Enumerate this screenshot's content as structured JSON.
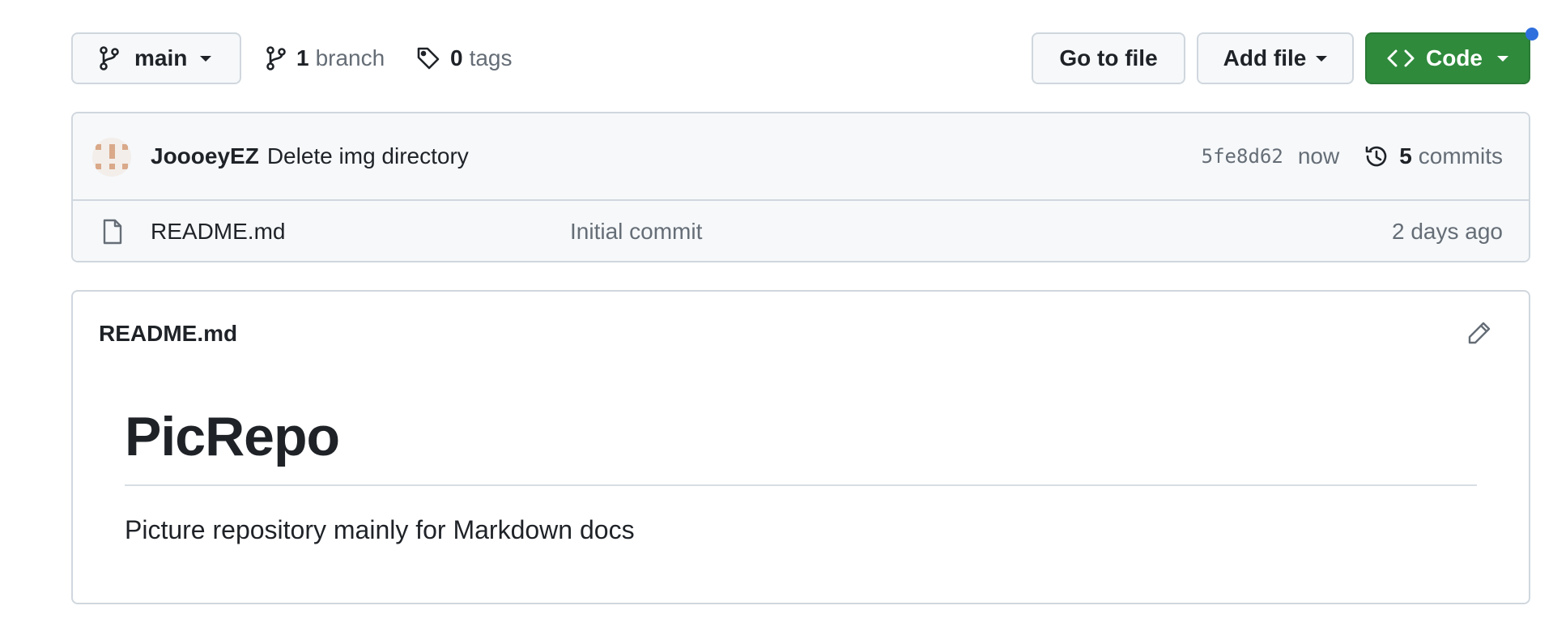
{
  "toolbar": {
    "branch_label": "main",
    "branches_count": "1",
    "branches_label": "branch",
    "tags_count": "0",
    "tags_label": "tags",
    "goto_file_label": "Go to file",
    "add_file_label": "Add file",
    "code_label": "Code"
  },
  "latest_commit": {
    "author": "JoooeyEZ",
    "message": "Delete img directory",
    "sha": "5fe8d62",
    "when": "now",
    "commits_count": "5",
    "commits_label": "commits"
  },
  "files": [
    {
      "name": "README.md",
      "commit_message": "Initial commit",
      "age": "2 days ago",
      "icon": "file-icon"
    }
  ],
  "readme": {
    "filename": "README.md",
    "heading": "PicRepo",
    "description": "Picture repository mainly for Markdown docs"
  },
  "colors": {
    "code_button": "#2f8a3c",
    "notification_dot": "#2f6fdd",
    "muted_text": "#656d76",
    "border": "#d0d7de"
  }
}
